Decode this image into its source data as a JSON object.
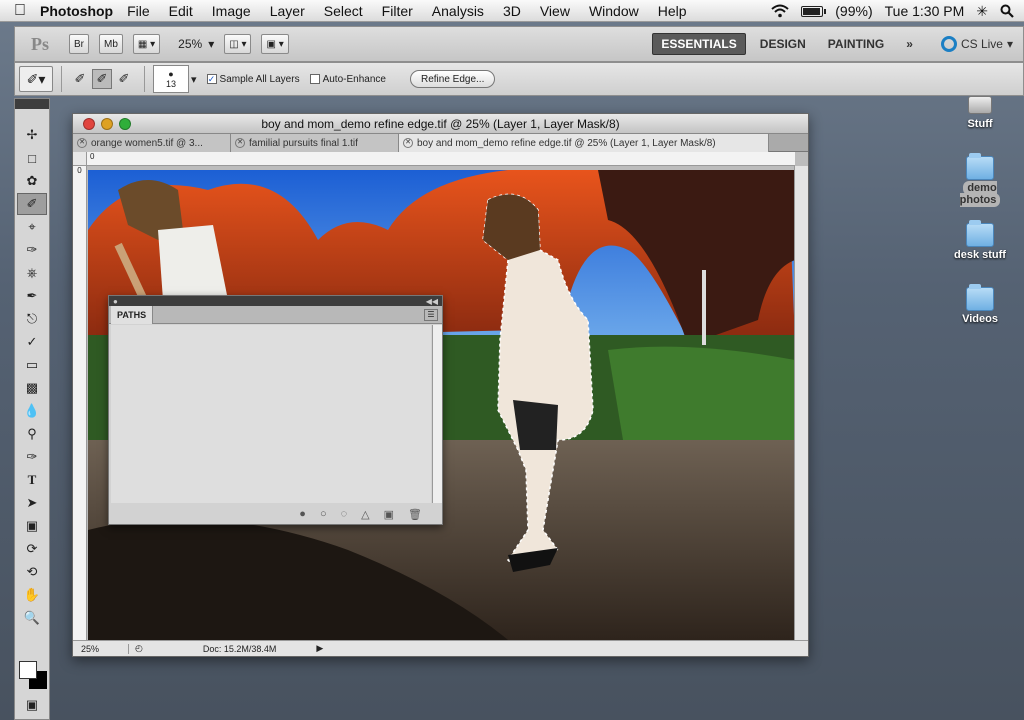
{
  "menubar": {
    "app_name": "Photoshop",
    "items": [
      "File",
      "Edit",
      "Image",
      "Layer",
      "Select",
      "Filter",
      "Analysis",
      "3D",
      "View",
      "Window",
      "Help"
    ],
    "battery": "(99%)",
    "battery_level": 0.99,
    "clock": "Tue 1:30 PM"
  },
  "appbar": {
    "logo": "Ps",
    "bridge": "Br",
    "minibridge": "Mb",
    "zoom": "25%",
    "workspaces": [
      "ESSENTIALS",
      "DESIGN",
      "PAINTING"
    ],
    "active_workspace": "ESSENTIALS",
    "cs_live": "CS Live"
  },
  "options": {
    "brush_size": "13",
    "sample_all_layers": "Sample All Layers",
    "auto_enhance": "Auto-Enhance",
    "refine_edge": "Refine Edge..."
  },
  "document": {
    "title": "boy and mom_demo refine edge.tif @ 25% (Layer 1, Layer Mask/8)",
    "tabs": [
      "orange women5.tif @ 3...",
      "familial pursuits final 1.tif",
      "boy and mom_demo refine edge.tif @ 25% (Layer 1, Layer Mask/8)"
    ],
    "ruler_origin": "0",
    "status_zoom": "25%",
    "status_doc": "Doc: 15.2M/38.4M"
  },
  "paths_panel": {
    "tab": "PATHS"
  },
  "desktop": {
    "icons": [
      "Stuff",
      "demo photos",
      "desk stuff",
      "Videos"
    ]
  },
  "colors": {
    "workspace_active": "#5a5a5a",
    "cs_live": "#1b7fc4"
  }
}
